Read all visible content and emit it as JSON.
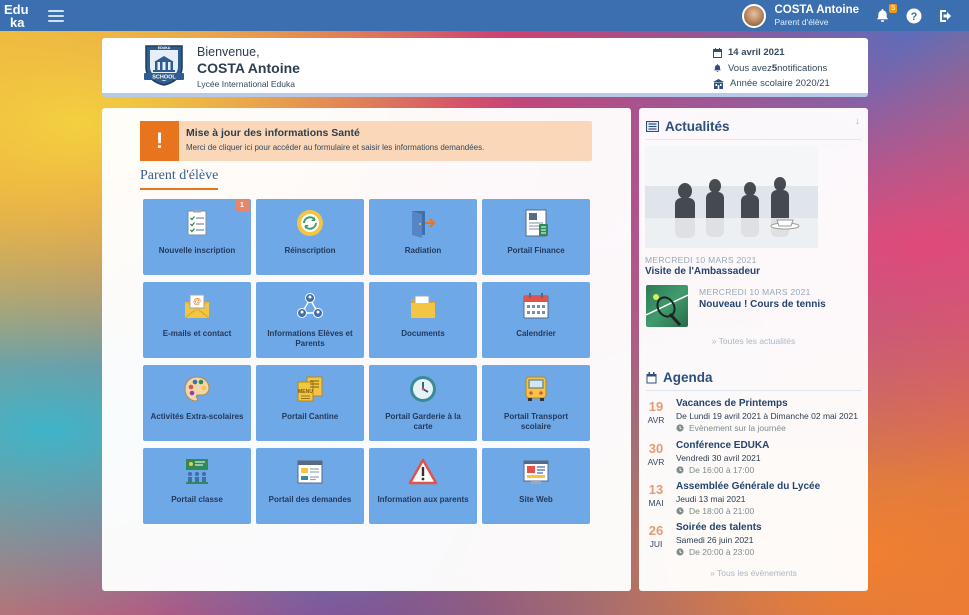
{
  "topbar": {
    "logo_line1": "Edu",
    "logo_line2": "ka",
    "user_name": "COSTA Antoine",
    "user_role": "Parent d'élève",
    "notif_count": "5"
  },
  "welcome": {
    "greeting": "Bienvenue,",
    "name": "COSTA Antoine",
    "school": "Lycée International Eduka",
    "logo_top": "EDUKA",
    "logo_bottom": "SCHOOL",
    "date": "14 avril 2021",
    "notif_prefix": "Vous avez ",
    "notif_count": "5",
    "notif_suffix": " notifications",
    "school_year": "Année scolaire 2020/21"
  },
  "alert": {
    "icon": "!",
    "title": "Mise à jour des informations Santé",
    "text": "Merci de cliquer ici pour accéder au formulaire et saisir les informations demandées."
  },
  "section_title": "Parent d'élève",
  "tiles": [
    {
      "label": "Nouvelle inscription",
      "icon": "checklist-icon",
      "badge": "1"
    },
    {
      "label": "Réinscription",
      "icon": "refresh-circle-icon"
    },
    {
      "label": "Radiation",
      "icon": "door-exit-icon"
    },
    {
      "label": "Portail Finance",
      "icon": "finance-icon"
    },
    {
      "label": "E-mails et contact",
      "icon": "email-icon"
    },
    {
      "label": "Informations Elèves et Parents",
      "icon": "people-network-icon"
    },
    {
      "label": "Documents",
      "icon": "folder-icon"
    },
    {
      "label": "Calendrier",
      "icon": "calendar-icon"
    },
    {
      "label": "Activités Extra-scolaires",
      "icon": "palette-icon"
    },
    {
      "label": "Portail Cantine",
      "icon": "menu-board-icon",
      "sub": "MENU"
    },
    {
      "label": "Portail Garderie à la carte",
      "icon": "clock-icon"
    },
    {
      "label": "Portail Transport scolaire",
      "icon": "school-bus-icon"
    },
    {
      "label": "Portail classe",
      "icon": "classroom-icon"
    },
    {
      "label": "Portail des demandes",
      "icon": "forms-icon"
    },
    {
      "label": "Information aux parents",
      "icon": "warning-icon"
    },
    {
      "label": "Site Web",
      "icon": "website-icon"
    }
  ],
  "news": {
    "title": "Actualités",
    "items": [
      {
        "date": "MERCREDI 10 MARS 2021",
        "title": "Visite de l'Ambassadeur"
      },
      {
        "date": "MERCREDI 10 MARS 2021",
        "title": "Nouveau ! Cours de tennis"
      }
    ],
    "more": "» Toutes les actualités"
  },
  "agenda": {
    "title": "Agenda",
    "items": [
      {
        "day": "19",
        "month": "AVR",
        "title": "Vacances de Printemps",
        "date": "De Lundi 19 avril 2021 à Dimanche 02 mai 2021",
        "time": "Evènement sur la journée"
      },
      {
        "day": "30",
        "month": "AVR",
        "title": "Conférence EDUKA",
        "date": "Vendredi 30 avril 2021",
        "time": "De 16:00 à 17:00"
      },
      {
        "day": "13",
        "month": "MAI",
        "title": "Assemblée Générale du Lycée",
        "date": "Jeudi 13 mai 2021",
        "time": "De 18:00 à 21:00"
      },
      {
        "day": "26",
        "month": "JUI",
        "title": "Soirée des talents",
        "date": "Samedi 26 juin 2021",
        "time": "De 20:00 à 23:00"
      }
    ],
    "more": "» Tous les évènements"
  },
  "colors": {
    "topbar": "#3b6fb0",
    "tile": "#6fa8e6",
    "accent_orange": "#e8741e",
    "alert_bg": "#f9d7b8",
    "agenda_day": "#e69a72"
  }
}
